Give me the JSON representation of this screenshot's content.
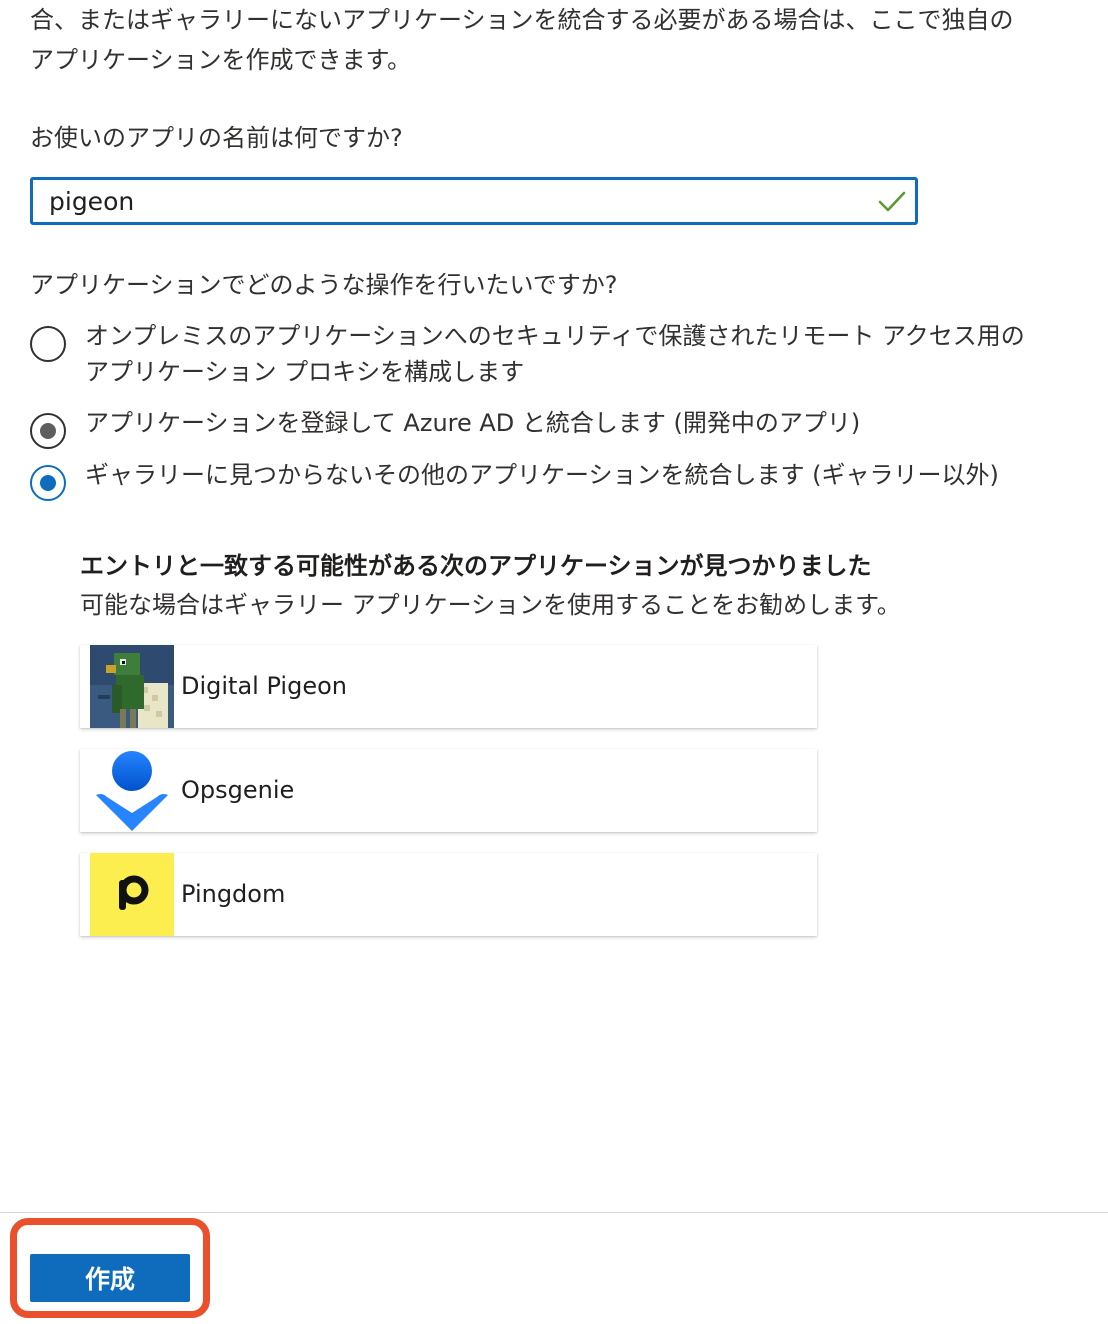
{
  "intro": {
    "line1": "合、またはギャラリーにないアプリケーションを統合する必要がある場合は、ここで独自の",
    "line2": "アプリケーションを作成できます。"
  },
  "name_question": "お使いのアプリの名前は何ですか?",
  "name_input": {
    "value": "pigeon",
    "status_icon": "check-icon",
    "status_color": "#5b9b2f"
  },
  "operation_question": "アプリケーションでどのような操作を行いたいですか?",
  "options": [
    {
      "label_line1": "オンプレミスのアプリケーションへのセキュリティで保護されたリモート アクセス用の",
      "label_line2": "アプリケーション プロキシを構成します",
      "state": "unselected"
    },
    {
      "label": "アプリケーションを登録して Azure AD と統合します (開発中のアプリ)",
      "state": "disabled-selected"
    },
    {
      "label": "ギャラリーに見つからないその他のアプリケーションを統合します (ギャラリー以外)",
      "state": "selected"
    }
  ],
  "recommendation": {
    "title": "エントリと一致する可能性がある次のアプリケーションが見つかりました",
    "subtitle": "可能な場合はギャラリー アプリケーションを使用することをお勧めします。",
    "apps": [
      {
        "name": "Digital Pigeon",
        "logo": "digital-pigeon-logo"
      },
      {
        "name": "Opsgenie",
        "logo": "opsgenie-logo"
      },
      {
        "name": "Pingdom",
        "logo": "pingdom-logo"
      }
    ]
  },
  "footer": {
    "create_label": "作成"
  },
  "colors": {
    "accent": "#0f6cbd",
    "highlight": "#e9502b",
    "selected_dot": "#0f6cbd",
    "disabled_dot": "#605e5c"
  }
}
